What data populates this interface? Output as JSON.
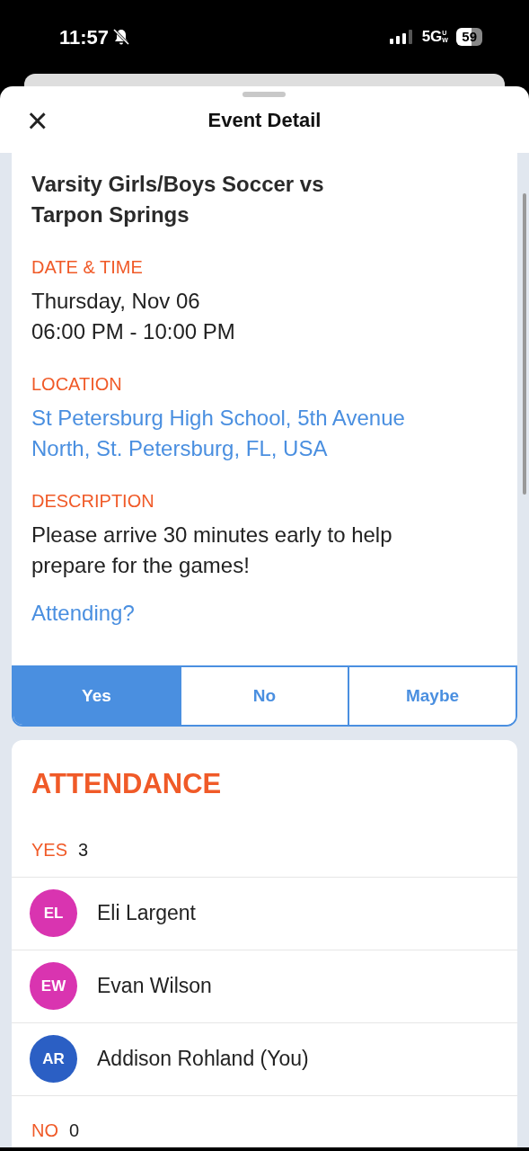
{
  "status_bar": {
    "time": "11:57",
    "network": "5G",
    "network_sub": "UW",
    "battery": "59"
  },
  "header": {
    "title": "Event Detail",
    "close": "×"
  },
  "event": {
    "title": "Varsity Girls/Boys Soccer vs Tarpon Springs",
    "sections": [
      {
        "label": "DATE & TIME",
        "kind": "text",
        "lines": [
          "Thursday, Nov 06",
          "06:00 PM - 10:00 PM"
        ]
      },
      {
        "label": "LOCATION",
        "kind": "link",
        "lines": [
          "St Petersburg High School, 5th Avenue North, St. Petersburg, FL, USA"
        ]
      },
      {
        "label": "DESCRIPTION",
        "kind": "text",
        "lines": [
          "Please arrive 30 minutes early to help prepare for the games!"
        ]
      }
    ],
    "attending_prompt": "Attending?",
    "rsvp": [
      {
        "label": "Yes",
        "selected": true
      },
      {
        "label": "No",
        "selected": false
      },
      {
        "label": "Maybe",
        "selected": false
      }
    ]
  },
  "attendance": {
    "title": "ATTENDANCE",
    "groups": [
      {
        "label": "YES",
        "count": "3",
        "people": [
          {
            "initials": "EL",
            "name": "Eli Largent",
            "color": "#d934b0"
          },
          {
            "initials": "EW",
            "name": "Evan Wilson",
            "color": "#d934b0"
          },
          {
            "initials": "AR",
            "name": "Addison Rohland (You)",
            "color": "#2b5fc4"
          }
        ]
      },
      {
        "label": "NO",
        "count": "0"
      }
    ]
  }
}
